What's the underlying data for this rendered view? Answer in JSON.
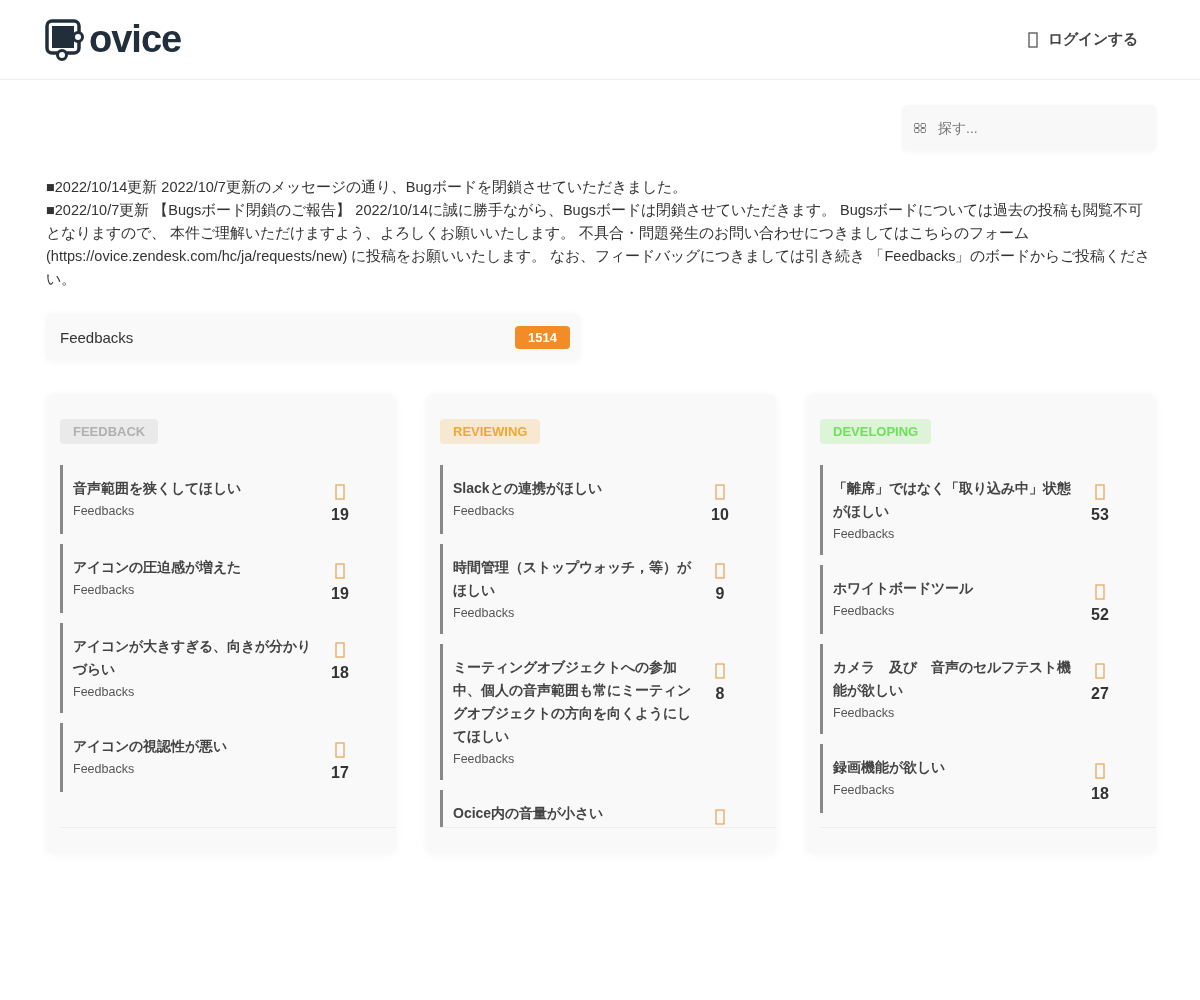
{
  "header": {
    "logo": "ovice",
    "login": "ログインする"
  },
  "search": {
    "placeholder": "探す..."
  },
  "notice": [
    "■2022/10/14更新 2022/10/7更新のメッセージの通り、Bugボードを閉鎖させていただきました。",
    "■2022/10/7更新 【Bugsボード閉鎖のご報告】 2022/10/14に誠に勝手ながら、Bugsボードは閉鎖させていただきます。 Bugsボードについては過去の投稿も閲覧不可となりますので、 本件ご理解いただけますよう、よろしくお願いいたします。 不具合・問題発生のお問い合わせにつきましてはこちらのフォーム (https://ovice.zendesk.com/hc/ja/requests/new) に投稿をお願いいたします。 なお、フィードバッグにつきましては引き続き 「Feedbacks」のボードからご投稿ください。"
  ],
  "board": {
    "name": "Feedbacks",
    "count": "1514"
  },
  "columns": [
    {
      "status": "FEEDBACK",
      "color": "#b0b0b0",
      "posts": [
        {
          "title": "音声範囲を狭くしてほしい",
          "board": "Feedbacks",
          "votes": "19"
        },
        {
          "title": "アイコンの圧迫感が増えた",
          "board": "Feedbacks",
          "votes": "19"
        },
        {
          "title": "アイコンが大きすぎる、向きが分かりづらい",
          "board": "Feedbacks",
          "votes": "18"
        },
        {
          "title": "アイコンの視認性が悪い",
          "board": "Feedbacks",
          "votes": "17"
        }
      ]
    },
    {
      "status": "REVIEWING",
      "color": "#f0a830",
      "posts": [
        {
          "title": "Slackとの連携がほしい",
          "board": "Feedbacks",
          "votes": "10"
        },
        {
          "title": "時間管理（ストップウォッチ，等）がほしい",
          "board": "Feedbacks",
          "votes": "9"
        },
        {
          "title": "ミーティングオブジェクトへの参加中、個人の音声範囲も常にミーティングオブジェクトの方向を向くようにしてほしい",
          "board": "Feedbacks",
          "votes": "8"
        },
        {
          "title": "Ocice内の音量が小さい"
        }
      ]
    },
    {
      "status": "DEVELOPING",
      "color": "#6ee05a",
      "posts": [
        {
          "title": "「離席」ではなく「取り込み中」状態がほしい",
          "board": "Feedbacks",
          "votes": "53"
        },
        {
          "title": "ホワイトボードツール",
          "board": "Feedbacks",
          "votes": "52"
        },
        {
          "title": "カメラ　及び　音声のセルフテスト機能が欲しい",
          "board": "Feedbacks",
          "votes": "27"
        },
        {
          "title": "録画機能が欲しい",
          "board": "Feedbacks",
          "votes": "18"
        }
      ]
    }
  ]
}
